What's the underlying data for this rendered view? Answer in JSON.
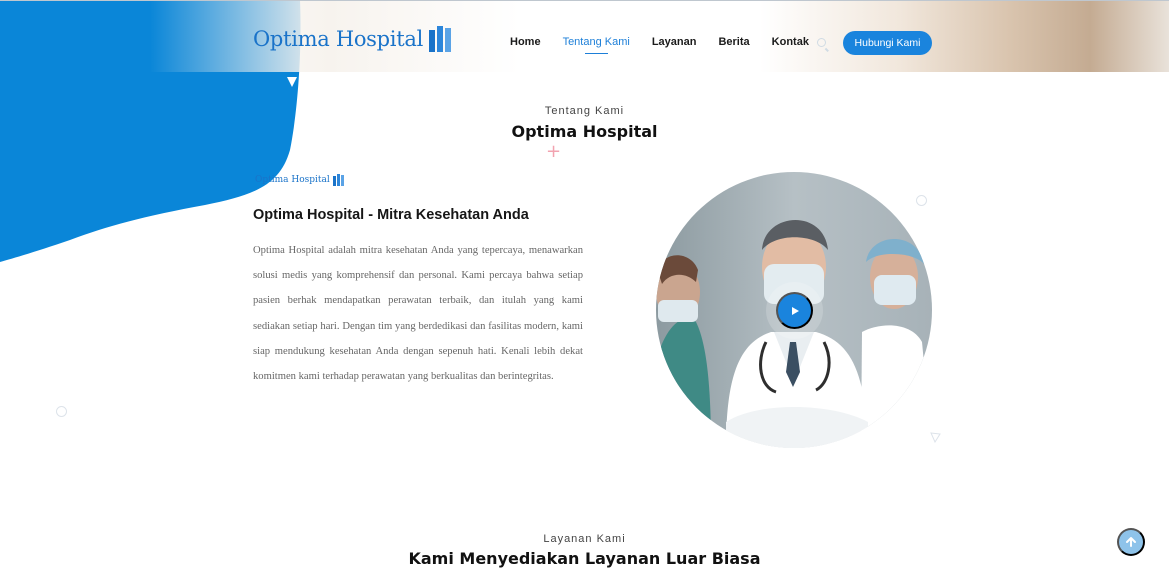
{
  "header": {
    "logo_text": "Optima Hospital",
    "nav": [
      {
        "label": "Home",
        "active": false
      },
      {
        "label": "Tentang Kami",
        "active": true
      },
      {
        "label": "Layanan",
        "active": false
      },
      {
        "label": "Berita",
        "active": false
      },
      {
        "label": "Kontak",
        "active": false
      }
    ],
    "search_icon": "search-icon",
    "cta_label": "Hubungi Kami"
  },
  "about": {
    "eyebrow": "Tentang Kami",
    "heading": "Optima Hospital",
    "mini_logo_text": "Optima Hospital",
    "title": "Optima Hospital - Mitra Kesehatan Anda",
    "body": "Optima Hospital adalah mitra kesehatan Anda yang tepercaya, menawarkan solusi medis yang komprehensif dan personal. Kami percaya bahwa setiap pasien berhak mendapatkan perawatan terbaik, dan itulah yang kami sediakan setiap hari. Dengan tim yang berdedikasi dan fasilitas modern, kami siap mendukung kesehatan Anda dengan sepenuh hati. Kenali lebih dekat komitmen kami terhadap perawatan yang berkualitas dan berintegritas.",
    "video_button_icon": "play-icon"
  },
  "services": {
    "eyebrow": "Layanan Kami",
    "heading": "Kami Menyediakan Layanan Luar Biasa"
  },
  "scroll_top_icon": "arrow-up-icon",
  "colors": {
    "brand_blue": "#1a84dd",
    "logo_blue": "#1a73c9",
    "accent_pink": "#f2a3b0",
    "blob_blue": "#0a86d8"
  }
}
